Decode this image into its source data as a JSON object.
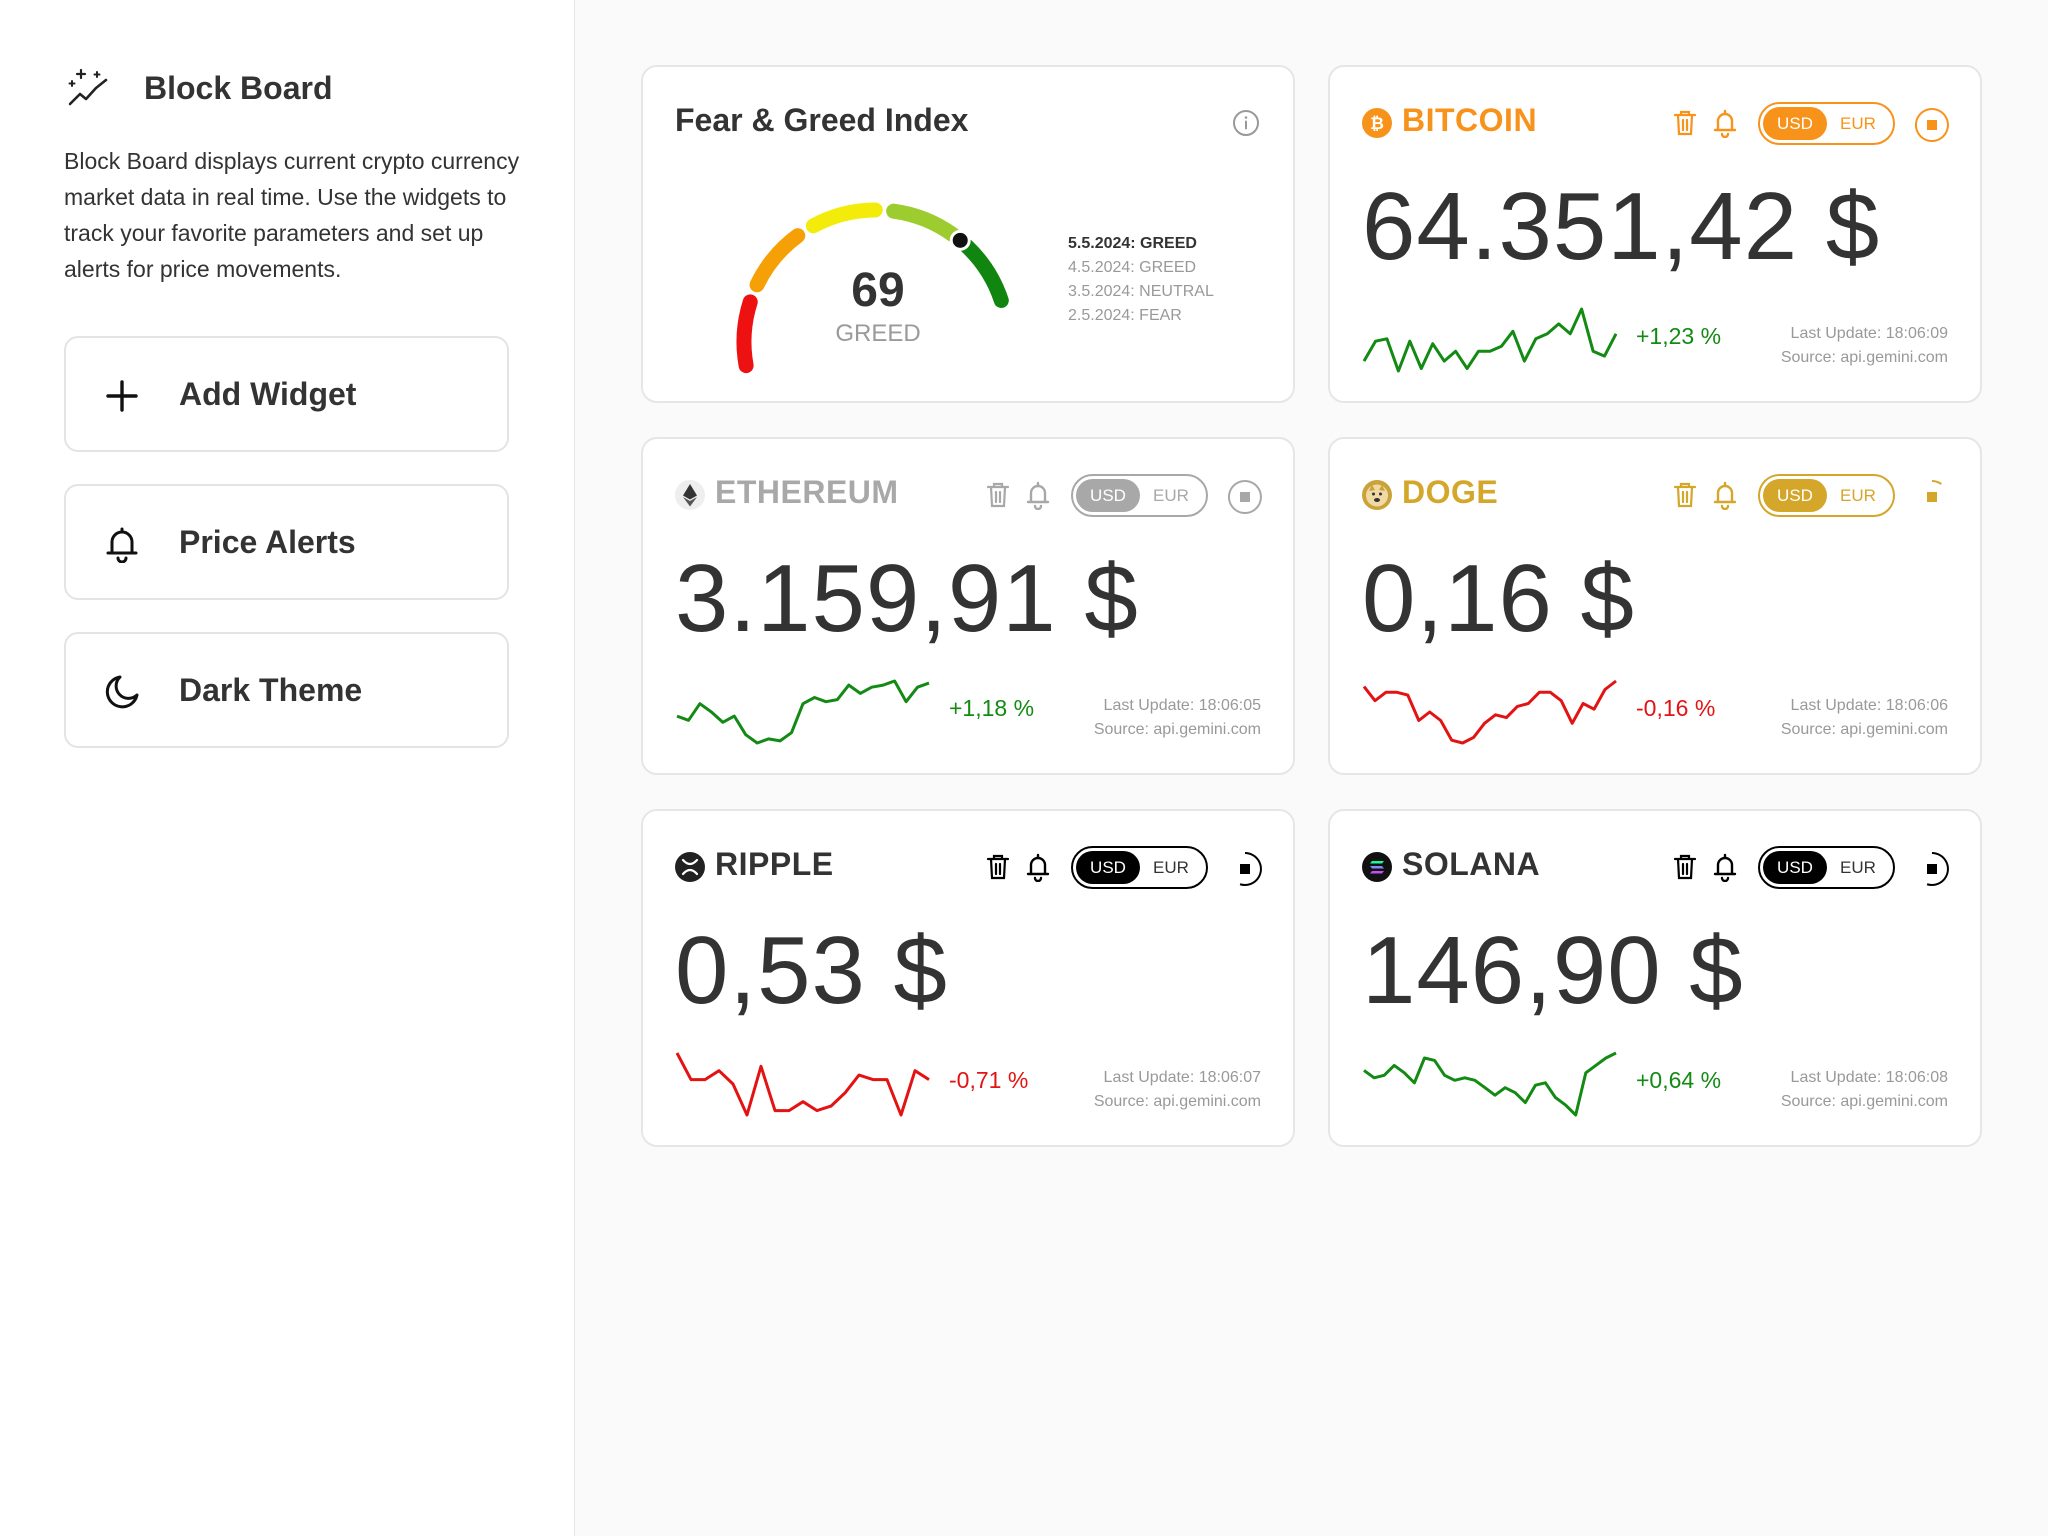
{
  "sidebar": {
    "app_name": "Block Board",
    "description": "Block Board displays current crypto currency market data in real time. Use the widgets to track your favorite parameters and set up alerts for price movements.",
    "buttons": [
      {
        "label": "Add Widget",
        "icon": "plus-icon"
      },
      {
        "label": "Price Alerts",
        "icon": "bell-icon"
      },
      {
        "label": "Dark Theme",
        "icon": "moon-icon"
      }
    ]
  },
  "fear_greed": {
    "title": "Fear & Greed Index",
    "value": "69",
    "label": "GREED",
    "gauge_level": 0.69,
    "history": [
      "5.5.2024: GREED",
      "4.5.2024: GREED",
      "3.5.2024: NEUTRAL",
      "2.5.2024: FEAR"
    ]
  },
  "widgets": [
    {
      "name": "BITCOIN",
      "icon": "bitcoin-icon",
      "accent": "#f7931a",
      "price": "64.351,42 $",
      "change": "+1,23 %",
      "trend": "up",
      "last_update": "Last Update: 18:06:09",
      "source": "Source: api.gemini.com",
      "usd": "USD",
      "eur": "EUR",
      "spark": [
        12,
        4,
        3,
        16,
        4,
        15,
        5,
        12,
        8,
        15,
        8,
        8,
        6,
        0,
        12,
        3,
        1,
        -3,
        1,
        -9,
        8,
        10,
        1
      ]
    },
    {
      "name": "ETHEREUM",
      "icon": "ethereum-icon",
      "accent": "#a8a8a8",
      "price": "3.159,91 $",
      "change": "+1,18 %",
      "trend": "up",
      "last_update": "Last Update: 18:06:05",
      "source": "Source: api.gemini.com",
      "usd": "USD",
      "eur": "EUR",
      "spark": [
        12,
        14,
        6,
        10,
        15,
        12,
        21,
        25,
        23,
        24,
        20,
        6,
        3,
        5,
        4,
        -3,
        1,
        -2,
        -3,
        -5,
        5,
        -2,
        -4
      ]
    },
    {
      "name": "DOGE",
      "icon": "doge-icon",
      "accent": "#d4a62a",
      "price": "0,16 $",
      "change": "-0,16 %",
      "trend": "down",
      "last_update": "Last Update: 18:06:06",
      "source": "Source: api.gemini.com",
      "usd": "USD",
      "eur": "EUR",
      "spark": [
        0,
        5,
        2,
        2,
        3,
        12,
        9,
        12,
        19,
        20,
        18,
        13,
        10,
        11,
        7,
        6,
        2,
        2,
        5,
        13,
        6,
        8,
        1,
        -2
      ]
    },
    {
      "name": "RIPPLE",
      "icon": "ripple-icon",
      "accent": "#000000",
      "price": "0,53 $",
      "change": "-0,71 %",
      "trend": "down",
      "last_update": "Last Update: 18:06:07",
      "source": "Source: api.gemini.com",
      "usd": "USD",
      "eur": "EUR",
      "spark": [
        0,
        6,
        6,
        4,
        7,
        14,
        3,
        13,
        13,
        11,
        13,
        12,
        9,
        5,
        6,
        6,
        14,
        4,
        6
      ]
    },
    {
      "name": "SOLANA",
      "icon": "solana-icon",
      "accent": "#000000",
      "price": "146,90 $",
      "change": "+0,64 %",
      "trend": "up",
      "last_update": "Last Update: 18:06:08",
      "source": "Source: api.gemini.com",
      "usd": "USD",
      "eur": "EUR",
      "spark": [
        10,
        13,
        12,
        8,
        11,
        15,
        5,
        6,
        12,
        14,
        13,
        14,
        17,
        20,
        17,
        19,
        23,
        16,
        15,
        21,
        24,
        28,
        11,
        8,
        5,
        3
      ]
    }
  ],
  "colors": {
    "up": "#138a13",
    "down": "#e31313",
    "text": "#333333",
    "muted": "#999999"
  }
}
